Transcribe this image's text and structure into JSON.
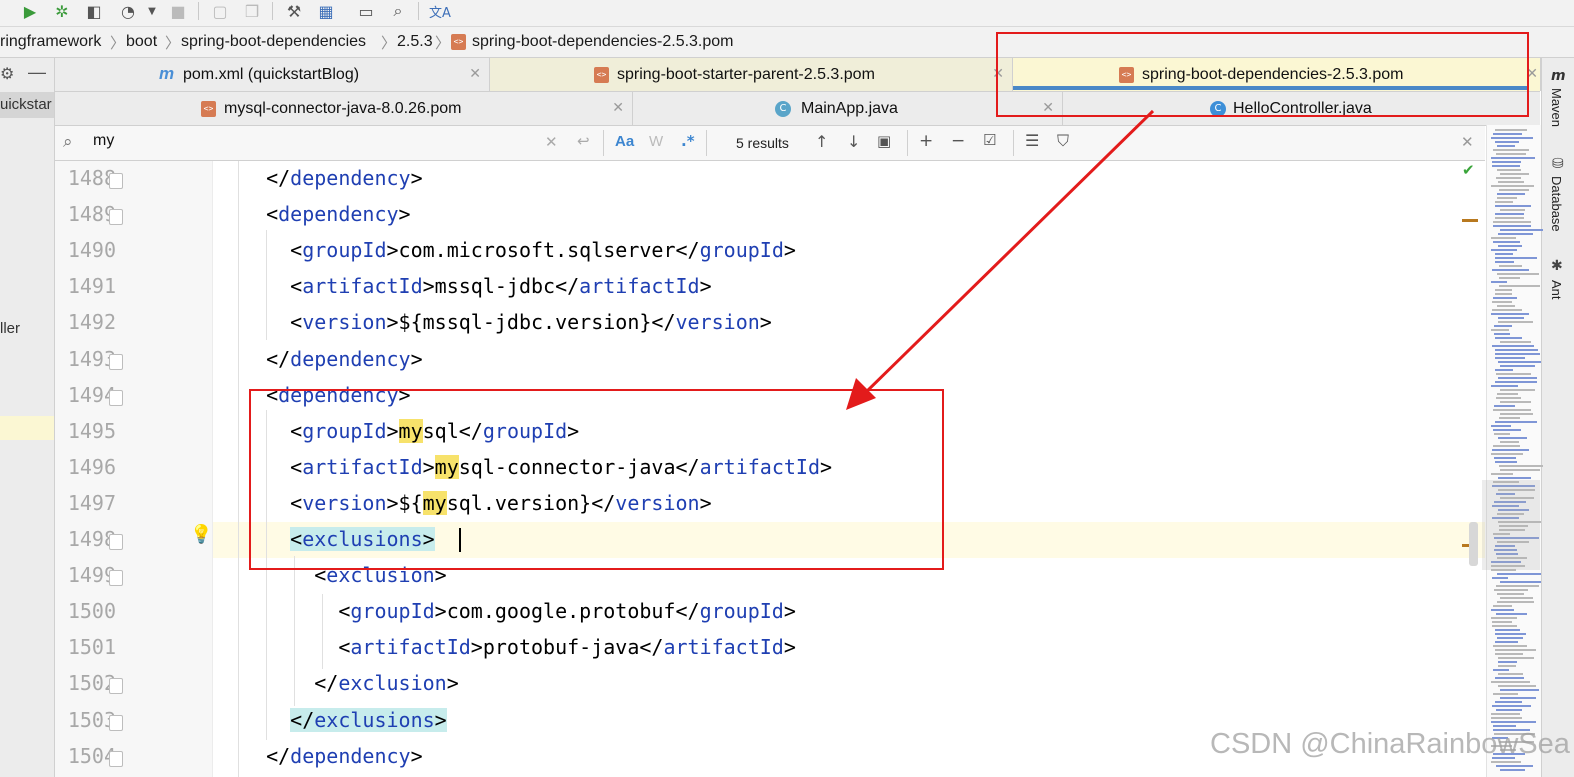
{
  "toolbar": {
    "icons": [
      "run-icon",
      "debug-icon",
      "coverage-icon",
      "profile-icon",
      "dropdown-icon",
      "stop-icon",
      "build-icon",
      "build-all-icon",
      "settings-wrench-icon",
      "project-structure-icon",
      "terminal-icon",
      "search-everywhere-icon",
      "translate-icon"
    ]
  },
  "breadcrumbs": [
    "ringframework",
    "boot",
    "spring-boot-dependencies",
    "2.5.3",
    "spring-boot-dependencies-2.5.3.pom"
  ],
  "left_panel": {
    "partial_label": "uickstar",
    "partial_item": "ller"
  },
  "tabs_row1": [
    {
      "label": "pom.xml (quickstartBlog)",
      "icon": "m",
      "active": false
    },
    {
      "label": "spring-boot-starter-parent-2.5.3.pom",
      "active": false
    },
    {
      "label": "spring-boot-dependencies-2.5.3.pom",
      "active": true
    }
  ],
  "tabs_row2": [
    {
      "label": "mysql-connector-java-8.0.26.pom"
    },
    {
      "label": "MainApp.java"
    },
    {
      "label": "HelloController.java"
    }
  ],
  "search": {
    "query": "my",
    "results": "5 results",
    "match_case": "Aa",
    "words": "W",
    "regex": ".*"
  },
  "right_tools": [
    "Maven",
    "Database",
    "Ant"
  ],
  "editor": {
    "lines": [
      {
        "n": "1488",
        "indent": 2,
        "parts": [
          [
            "p",
            "</"
          ],
          [
            "t",
            "dependency"
          ],
          [
            "p",
            ">"
          ]
        ]
      },
      {
        "n": "1489",
        "indent": 2,
        "parts": [
          [
            "p",
            "<"
          ],
          [
            "t",
            "dependency"
          ],
          [
            "p",
            ">"
          ]
        ]
      },
      {
        "n": "1490",
        "indent": 4,
        "parts": [
          [
            "p",
            "<"
          ],
          [
            "t",
            "groupId"
          ],
          [
            "p",
            ">com.microsoft.sqlserver</"
          ],
          [
            "t",
            "groupId"
          ],
          [
            "p",
            ">"
          ]
        ]
      },
      {
        "n": "1491",
        "indent": 4,
        "parts": [
          [
            "p",
            "<"
          ],
          [
            "t",
            "artifactId"
          ],
          [
            "p",
            ">mssql-jdbc</"
          ],
          [
            "t",
            "artifactId"
          ],
          [
            "p",
            ">"
          ]
        ]
      },
      {
        "n": "1492",
        "indent": 4,
        "parts": [
          [
            "p",
            "<"
          ],
          [
            "t",
            "version"
          ],
          [
            "p",
            ">${mssql-jdbc.version}</"
          ],
          [
            "t",
            "version"
          ],
          [
            "p",
            ">"
          ]
        ]
      },
      {
        "n": "1493",
        "indent": 2,
        "parts": [
          [
            "p",
            "</"
          ],
          [
            "t",
            "dependency"
          ],
          [
            "p",
            ">"
          ]
        ]
      },
      {
        "n": "1494",
        "indent": 2,
        "parts": [
          [
            "p",
            "<"
          ],
          [
            "t",
            "dependency"
          ],
          [
            "p",
            ">"
          ]
        ]
      },
      {
        "n": "1495",
        "indent": 4,
        "parts": [
          [
            "p",
            "<"
          ],
          [
            "t",
            "groupId"
          ],
          [
            "p",
            ">"
          ],
          [
            "h",
            "my"
          ],
          [
            "p",
            "sql</"
          ],
          [
            "t",
            "groupId"
          ],
          [
            "p",
            ">"
          ]
        ]
      },
      {
        "n": "1496",
        "indent": 4,
        "parts": [
          [
            "p",
            "<"
          ],
          [
            "t",
            "artifactId"
          ],
          [
            "p",
            ">"
          ],
          [
            "h",
            "my"
          ],
          [
            "p",
            "sql-connector-java</"
          ],
          [
            "t",
            "artifactId"
          ],
          [
            "p",
            ">"
          ]
        ]
      },
      {
        "n": "1497",
        "indent": 4,
        "parts": [
          [
            "p",
            "<"
          ],
          [
            "t",
            "version"
          ],
          [
            "p",
            ">${"
          ],
          [
            "h",
            "my"
          ],
          [
            "p",
            "sql.version}</"
          ],
          [
            "t",
            "version"
          ],
          [
            "p",
            ">"
          ]
        ]
      },
      {
        "n": "1498",
        "indent": 4,
        "parts": [
          [
            "x",
            "<"
          ],
          [
            "xt",
            "exclusions"
          ],
          [
            "x",
            ">"
          ]
        ]
      },
      {
        "n": "1499",
        "indent": 6,
        "parts": [
          [
            "p",
            "<"
          ],
          [
            "t",
            "exclusion"
          ],
          [
            "p",
            ">"
          ]
        ]
      },
      {
        "n": "1500",
        "indent": 8,
        "parts": [
          [
            "p",
            "<"
          ],
          [
            "t",
            "groupId"
          ],
          [
            "p",
            ">com.google.protobuf</"
          ],
          [
            "t",
            "groupId"
          ],
          [
            "p",
            ">"
          ]
        ]
      },
      {
        "n": "1501",
        "indent": 8,
        "parts": [
          [
            "p",
            "<"
          ],
          [
            "t",
            "artifactId"
          ],
          [
            "p",
            ">protobuf-java</"
          ],
          [
            "t",
            "artifactId"
          ],
          [
            "p",
            ">"
          ]
        ]
      },
      {
        "n": "1502",
        "indent": 6,
        "parts": [
          [
            "p",
            "</"
          ],
          [
            "t",
            "exclusion"
          ],
          [
            "p",
            ">"
          ]
        ]
      },
      {
        "n": "1503",
        "indent": 4,
        "parts": [
          [
            "x",
            "</"
          ],
          [
            "xt",
            "exclusions"
          ],
          [
            "x",
            ">"
          ]
        ]
      },
      {
        "n": "1504",
        "indent": 2,
        "parts": [
          [
            "p",
            "</"
          ],
          [
            "t",
            "dependency"
          ],
          [
            "p",
            ">"
          ]
        ]
      }
    ]
  },
  "colors": {
    "annotation_red": "#e31b1b",
    "tag_blue": "#1f3fb2",
    "match_yellow": "#f7e26b",
    "paired_tag_cyan": "#c7ecec",
    "active_tab": "#fbf7d3"
  },
  "watermark": "CSDN @ChinaRainbowSea"
}
